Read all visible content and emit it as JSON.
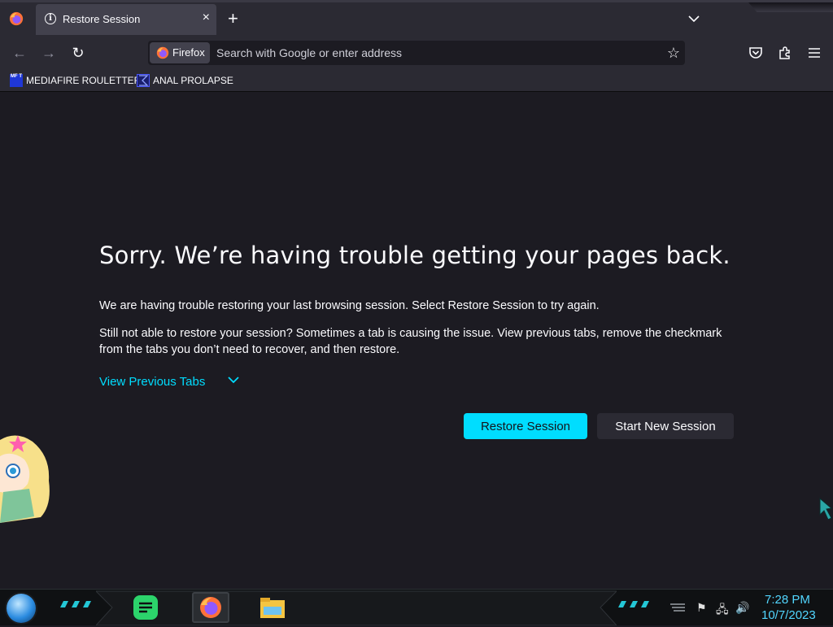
{
  "browser": {
    "tab": {
      "title": "Restore Session",
      "close": "×"
    },
    "newtab": "+",
    "nav": {
      "back": "←",
      "forward": "→",
      "reload": "↻"
    },
    "urlbar": {
      "identity_label": "Firefox",
      "placeholder": "Search with Google or enter address",
      "star": "☆"
    },
    "bookmarks": [
      {
        "label": "MEDIAFIRE ROULETTER",
        "icon": "mft-icon",
        "icon_text": "MF T"
      },
      {
        "label": "ANAL PROLAPSE",
        "icon": "sigma-icon"
      }
    ]
  },
  "page": {
    "heading": "Sorry. We’re having trouble getting your pages back.",
    "p1": "We are having trouble restoring your last browsing session. Select Restore Session to try again.",
    "p2": "Still not able to restore your session? Sometimes a tab is causing the issue. View previous tabs, remove the checkmark from the tabs you don’t need to recover, and then restore.",
    "view_previous": "View Previous Tabs",
    "restore_button": "Restore Session",
    "new_session_button": "Start New Session"
  },
  "taskbar": {
    "time": "7:28 PM",
    "date": "10/7/2023"
  },
  "colors": {
    "accent": "#00ddff",
    "chrome": "#2b2a33",
    "content_bg": "#1c1b22",
    "clock": "#52d6ff"
  }
}
